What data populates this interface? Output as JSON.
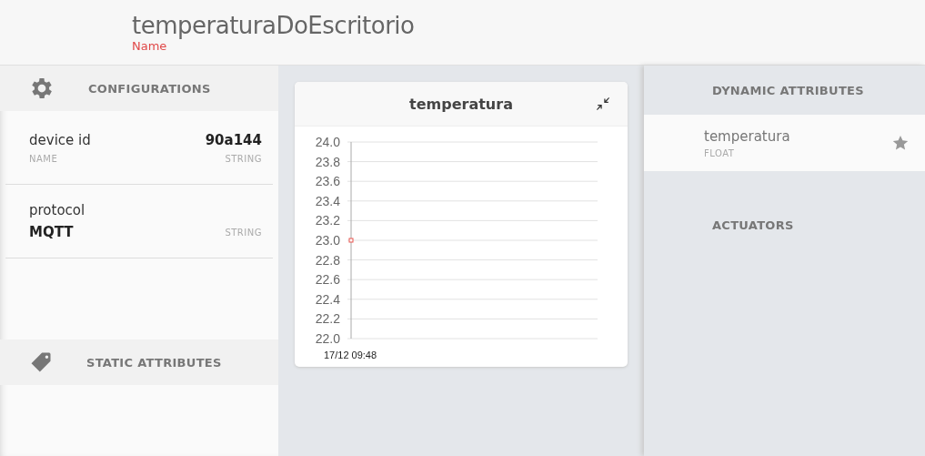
{
  "header": {
    "title": "temperaturaDoEscritorio",
    "subtitle": "Name"
  },
  "configurations": {
    "title": "CONFIGURATIONS",
    "items": [
      {
        "kind": "inline",
        "label": "device id",
        "value": "90a144",
        "meta": "NAME",
        "type": "STRING"
      },
      {
        "kind": "stacked",
        "label": "protocol",
        "value": "MQTT",
        "type": "STRING"
      }
    ]
  },
  "static_attributes": {
    "title": "STATIC ATTRIBUTES"
  },
  "chart_card": {
    "title": "temperatura",
    "chart_data": {
      "type": "line",
      "x": [
        "17/12 09:48"
      ],
      "grid": true,
      "series": [
        {
          "color": "#e8554e",
          "marker": true,
          "values": [
            23.0
          ]
        }
      ],
      "ylim": [
        22.0,
        24.0
      ],
      "yticks": [
        {
          "value": 24,
          "label": "24.0"
        },
        {
          "value": 23.8,
          "label": "23.8"
        },
        {
          "value": 23.6,
          "label": "23.6"
        },
        {
          "value": 23.4,
          "label": "23.4"
        },
        {
          "value": 23.2,
          "label": "23.2"
        },
        {
          "value": 23,
          "label": "23.0"
        },
        {
          "value": 22.8,
          "label": "22.8"
        },
        {
          "value": 22.6,
          "label": "22.6"
        },
        {
          "value": 22.4,
          "label": "22.4"
        },
        {
          "value": 22.2,
          "label": "22.2"
        },
        {
          "value": 22,
          "label": "22.0"
        }
      ]
    }
  },
  "dynamic_attributes": {
    "title": "DYNAMIC ATTRIBUTES",
    "items": [
      {
        "name": "temperatura",
        "type": "FLOAT"
      }
    ]
  },
  "actuators": {
    "title": "ACTUATORS"
  }
}
